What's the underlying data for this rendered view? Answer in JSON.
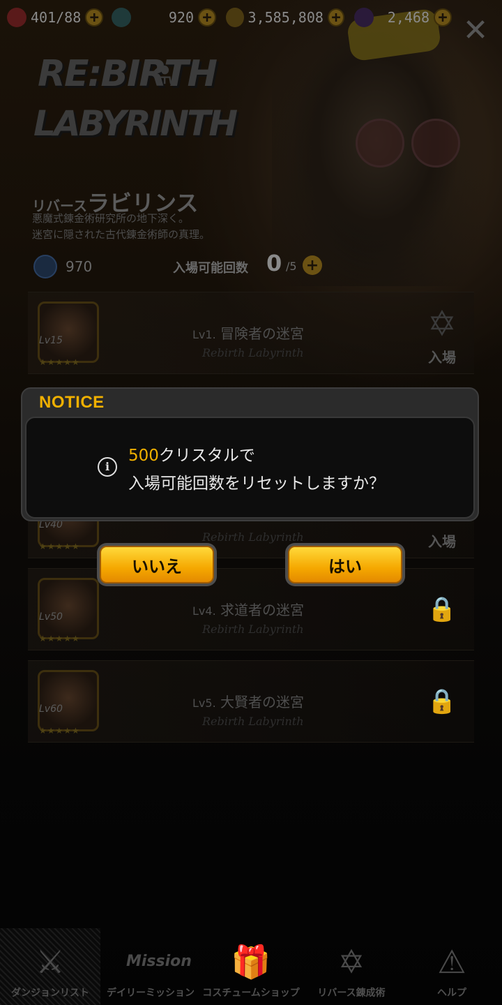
{
  "resources": [
    {
      "icon": "heart-icon",
      "value": "401/88",
      "color": "#5a1a1a"
    },
    {
      "icon": "gem-icon",
      "value": "920",
      "color": "#1f3a3a"
    },
    {
      "icon": "coin-icon",
      "value": "3,585,808",
      "color": "#4a3a10"
    },
    {
      "icon": "crystal-icon",
      "value": "2,468",
      "color": "#2a1a3a"
    }
  ],
  "header": {
    "logo_line1": "RE:BIRTH",
    "logo_line2": "LABYRINTH",
    "title_small": "リバース",
    "title_big": "ラビリンス",
    "desc1": "悪魔式錬金術研究所の地下深く。",
    "desc2": "迷宮に隠された古代錬金術師の真理。",
    "stat_value": "970",
    "entry_label": "入場可能回数",
    "entry_count": "0",
    "entry_max": "/5"
  },
  "dungeons": [
    {
      "lv_badge": "Lv15",
      "lv": "Lv1.",
      "name": "冒険者の迷宮",
      "sub": "Rebirth Labyrinth",
      "action": "入場",
      "locked": false,
      "stars": "★★★★★"
    },
    {
      "lv_badge": "Lv40",
      "lv": "",
      "name": "",
      "sub": "Rebirth Labyrinth",
      "action": "入場",
      "locked": false,
      "stars": "★★★★★"
    },
    {
      "lv_badge": "Lv50",
      "lv": "Lv4.",
      "name": "求道者の迷宮",
      "sub": "Rebirth Labyrinth",
      "action": "",
      "locked": true,
      "stars": "★★★★★"
    },
    {
      "lv_badge": "Lv60",
      "lv": "Lv5.",
      "name": "大賢者の迷宮",
      "sub": "Rebirth Labyrinth",
      "action": "",
      "locked": true,
      "stars": "★★★★★"
    }
  ],
  "dialog": {
    "title": "NOTICE",
    "amount": "500",
    "line1_rest": "クリスタルで",
    "line2": "入場可能回数をリセットしますか？",
    "no": "いいえ",
    "yes": "はい"
  },
  "nav": [
    {
      "icon": "crossed-swords-icon",
      "label": "ダンジョンリスト",
      "active": true
    },
    {
      "icon": "mission-icon",
      "label": "デイリーミッション",
      "active": false
    },
    {
      "icon": "gift-icon",
      "label": "コスチュームショップ",
      "active": false
    },
    {
      "icon": "alchemy-circle-icon",
      "label": "リバース錬成術",
      "active": false
    },
    {
      "icon": "info-icon",
      "label": "ヘルプ",
      "active": false
    }
  ],
  "overlay_info_symbol": "i",
  "accent_color": "#f0b000"
}
